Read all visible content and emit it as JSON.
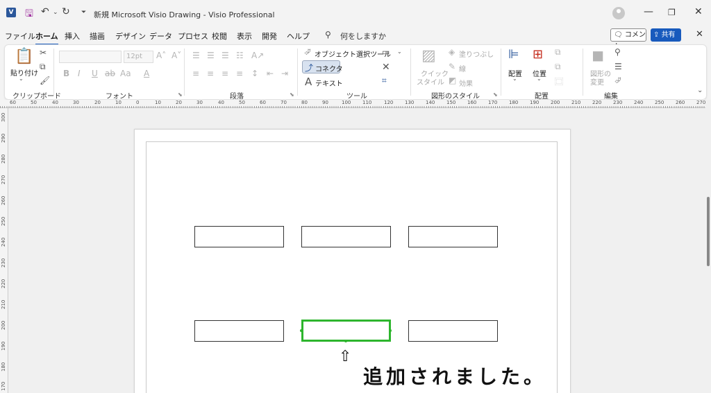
{
  "titlebar": {
    "app_logo": "V",
    "title": "新規 Microsoft Visio Drawing  -  Visio Professional"
  },
  "tabs": [
    "ファイル",
    "ホーム",
    "挿入",
    "描画",
    "デザイン",
    "データ",
    "プロセス",
    "校閲",
    "表示",
    "開発",
    "ヘルプ"
  ],
  "active_tab": "ホーム",
  "search": {
    "placeholder": "何をしますか"
  },
  "actions": {
    "comment": "コメント",
    "share": "共有"
  },
  "ribbon": {
    "clipboard": {
      "paste": "貼り付け",
      "label": "クリップボード"
    },
    "font": {
      "size": "12pt",
      "label": "フォント"
    },
    "paragraph": {
      "label": "段落"
    },
    "tools": {
      "pointer": "オブジェクト選択ツール",
      "connector": "コネクタ",
      "text": "テキスト",
      "label": "ツール"
    },
    "shape_styles": {
      "quick": "クイック",
      "styles": "スタイル",
      "fill": "塗りつぶし",
      "line": "線",
      "effects": "効果",
      "label": "図形のスタイル"
    },
    "arrange": {
      "align": "配置",
      "position": "位置",
      "label": "配置"
    },
    "editing": {
      "change_shape_1": "図形の",
      "change_shape_2": "変更",
      "label": "編集"
    }
  },
  "ruler": {
    "h_labels": [
      "60",
      "50",
      "40",
      "30",
      "20",
      "10",
      "0",
      "10",
      "20",
      "30",
      "40",
      "50",
      "60",
      "70",
      "80",
      "90",
      "100",
      "110",
      "120",
      "130",
      "140",
      "150",
      "160",
      "170",
      "180",
      "190",
      "200",
      "210",
      "220",
      "230",
      "240",
      "250",
      "260",
      "270"
    ],
    "v_labels": [
      "300",
      "290",
      "280",
      "270",
      "260",
      "250",
      "240",
      "230",
      "220",
      "210",
      "200",
      "190",
      "180",
      "170"
    ]
  },
  "annotation": {
    "arrow": "⇧",
    "caption": "追加されました。"
  },
  "colors": {
    "selection": "#2db52d",
    "accent": "#185abd"
  }
}
